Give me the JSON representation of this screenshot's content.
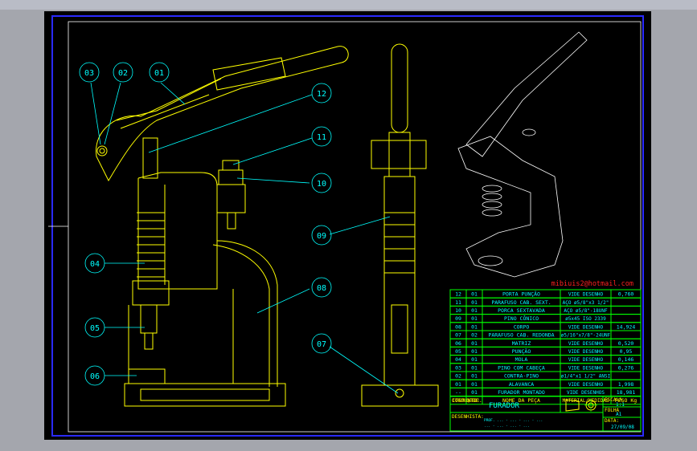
{
  "balloons": [
    "01",
    "02",
    "03",
    "04",
    "05",
    "06",
    "07",
    "08",
    "09",
    "10",
    "11",
    "12"
  ],
  "email": "mibiuis2@hotmail.com",
  "parts_list": {
    "rows": [
      {
        "item": "12",
        "qty": "01",
        "name": "PORTA PUNÇÃO",
        "material": "VIDE DESENHO",
        "weight": "0,760"
      },
      {
        "item": "11",
        "qty": "01",
        "name": "PARAFUSO CAB. SEXT.",
        "material": "AÇO ø5/8\"x3 1/2\"",
        "weight": ""
      },
      {
        "item": "10",
        "qty": "01",
        "name": "PORCA SEXTAVADA",
        "material": "AÇO ø5/8\"-18UNF",
        "weight": ""
      },
      {
        "item": "09",
        "qty": "01",
        "name": "PINO CÔNICO",
        "material": "ø5x45 ISO 2339",
        "weight": ""
      },
      {
        "item": "08",
        "qty": "01",
        "name": "CORPO",
        "material": "VIDE DESENHO",
        "weight": "14,924"
      },
      {
        "item": "07",
        "qty": "02",
        "name": "PARAFUSO CAB. REDONDA",
        "material": "ø5/16\"x7/8\"-24UNF",
        "weight": ""
      },
      {
        "item": "06",
        "qty": "01",
        "name": "MATRIZ",
        "material": "VIDE DESENHO",
        "weight": "0,520"
      },
      {
        "item": "05",
        "qty": "01",
        "name": "PUNÇÃO",
        "material": "VIDE DESENHO",
        "weight": "0,95"
      },
      {
        "item": "04",
        "qty": "01",
        "name": "MOLA",
        "material": "VIDE DESENHO",
        "weight": "0,146"
      },
      {
        "item": "03",
        "qty": "01",
        "name": "PINO COM CABEÇA",
        "material": "VIDE DESENHO",
        "weight": "0,276"
      },
      {
        "item": "02",
        "qty": "01",
        "name": "CONTRA-PINO",
        "material": "ø1/4\"x1 1/2\" ANSI",
        "weight": ""
      },
      {
        "item": "01",
        "qty": "01",
        "name": "ALAVANCA",
        "material": "VIDE DESENHO",
        "weight": "1,998"
      },
      {
        "item": "--",
        "qty": "01",
        "name": "FURADOR MONTADO",
        "material": "VIDE DESENHOS",
        "weight": "18,981"
      }
    ],
    "headers": {
      "item": "ITEM",
      "qty": "QTDE.",
      "name": "NOME DA PEÇA",
      "material": "MATERIAL/MEDIDAS",
      "weight": "PESO Kg"
    }
  },
  "title_block": {
    "conjunto_label": "CONJUNTO:",
    "conjunto_value": "FURADOR",
    "escala_label": "ESCALA",
    "escala_value": "1:1",
    "folha_label": "FOLHA",
    "folha_value": "A1",
    "desenhista_label": "DESENHISTA:",
    "desenhista_line1": "PROF. ... - ... - ... - ...",
    "desenhista_line2": "... - ... - ... - ...",
    "data_label": "DATA:",
    "data_value": "27/09/08"
  },
  "colors": {
    "background": "#000000",
    "frame": "#2222ff",
    "parts": "#ffff00",
    "table": "#00ff00",
    "text": "#00ffff",
    "email": "#ff2020"
  }
}
